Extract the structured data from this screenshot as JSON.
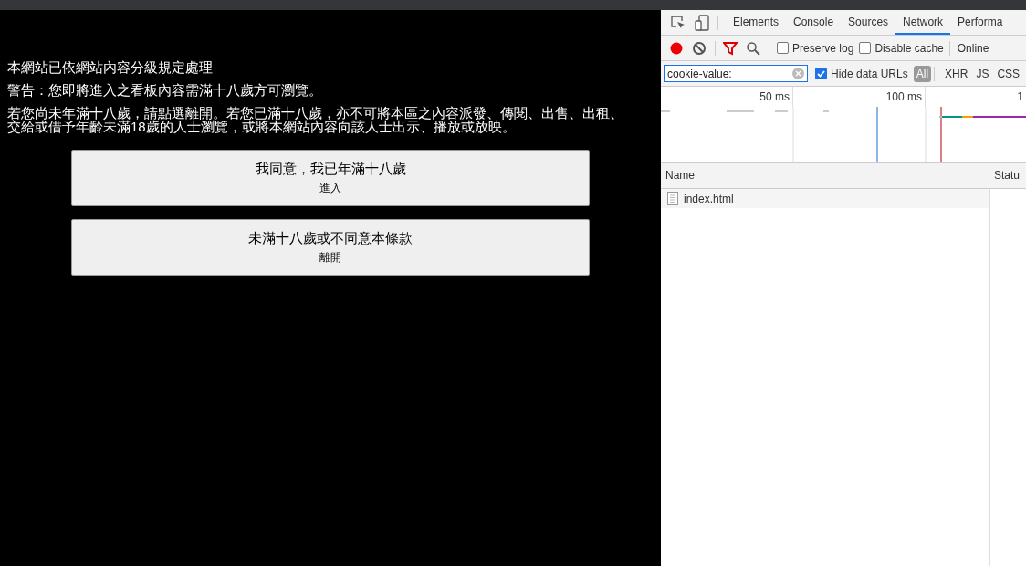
{
  "page": {
    "notices": [
      "本網站已依網站內容分級規定處理",
      "警告：您即將進入之看板內容需滿十八歲方可瀏覽。",
      "若您尚未年滿十八歲，請點選離開。若您已滿十八歲，亦不可將本區之內容派發、傳閱、出售、出租、交給或借予年齡未滿18歲的人士瀏覽，或將本網站內容向該人士出示、播放或放映。"
    ],
    "buttons": [
      {
        "label": "我同意，我已年滿十八歲",
        "sublabel": "進入"
      },
      {
        "label": "未滿十八歲或不同意本條款",
        "sublabel": "離開"
      }
    ]
  },
  "devtools": {
    "tabs": [
      {
        "label": "Elements",
        "selected": false
      },
      {
        "label": "Console",
        "selected": false
      },
      {
        "label": "Sources",
        "selected": false
      },
      {
        "label": "Network",
        "selected": true
      },
      {
        "label": "Performa",
        "selected": false
      }
    ],
    "toolbar": {
      "recording": true,
      "preserve_log": {
        "label": "Preserve log",
        "checked": false
      },
      "disable_cache": {
        "label": "Disable cache",
        "checked": false
      },
      "throttling": "Online"
    },
    "filter": {
      "value": "cookie-value:",
      "hide_data_urls": {
        "label": "Hide data URLs",
        "checked": true
      },
      "types": [
        {
          "label": "All",
          "selected": true
        },
        {
          "label": "XHR",
          "selected": false
        },
        {
          "label": "JS",
          "selected": false
        },
        {
          "label": "CSS",
          "selected": false
        }
      ]
    },
    "timeline": {
      "ticks": [
        "50 ms",
        "100 ms",
        "1"
      ]
    },
    "table": {
      "columns": [
        "Name",
        "Statu"
      ],
      "rows": [
        {
          "name": "index.html"
        }
      ]
    }
  }
}
